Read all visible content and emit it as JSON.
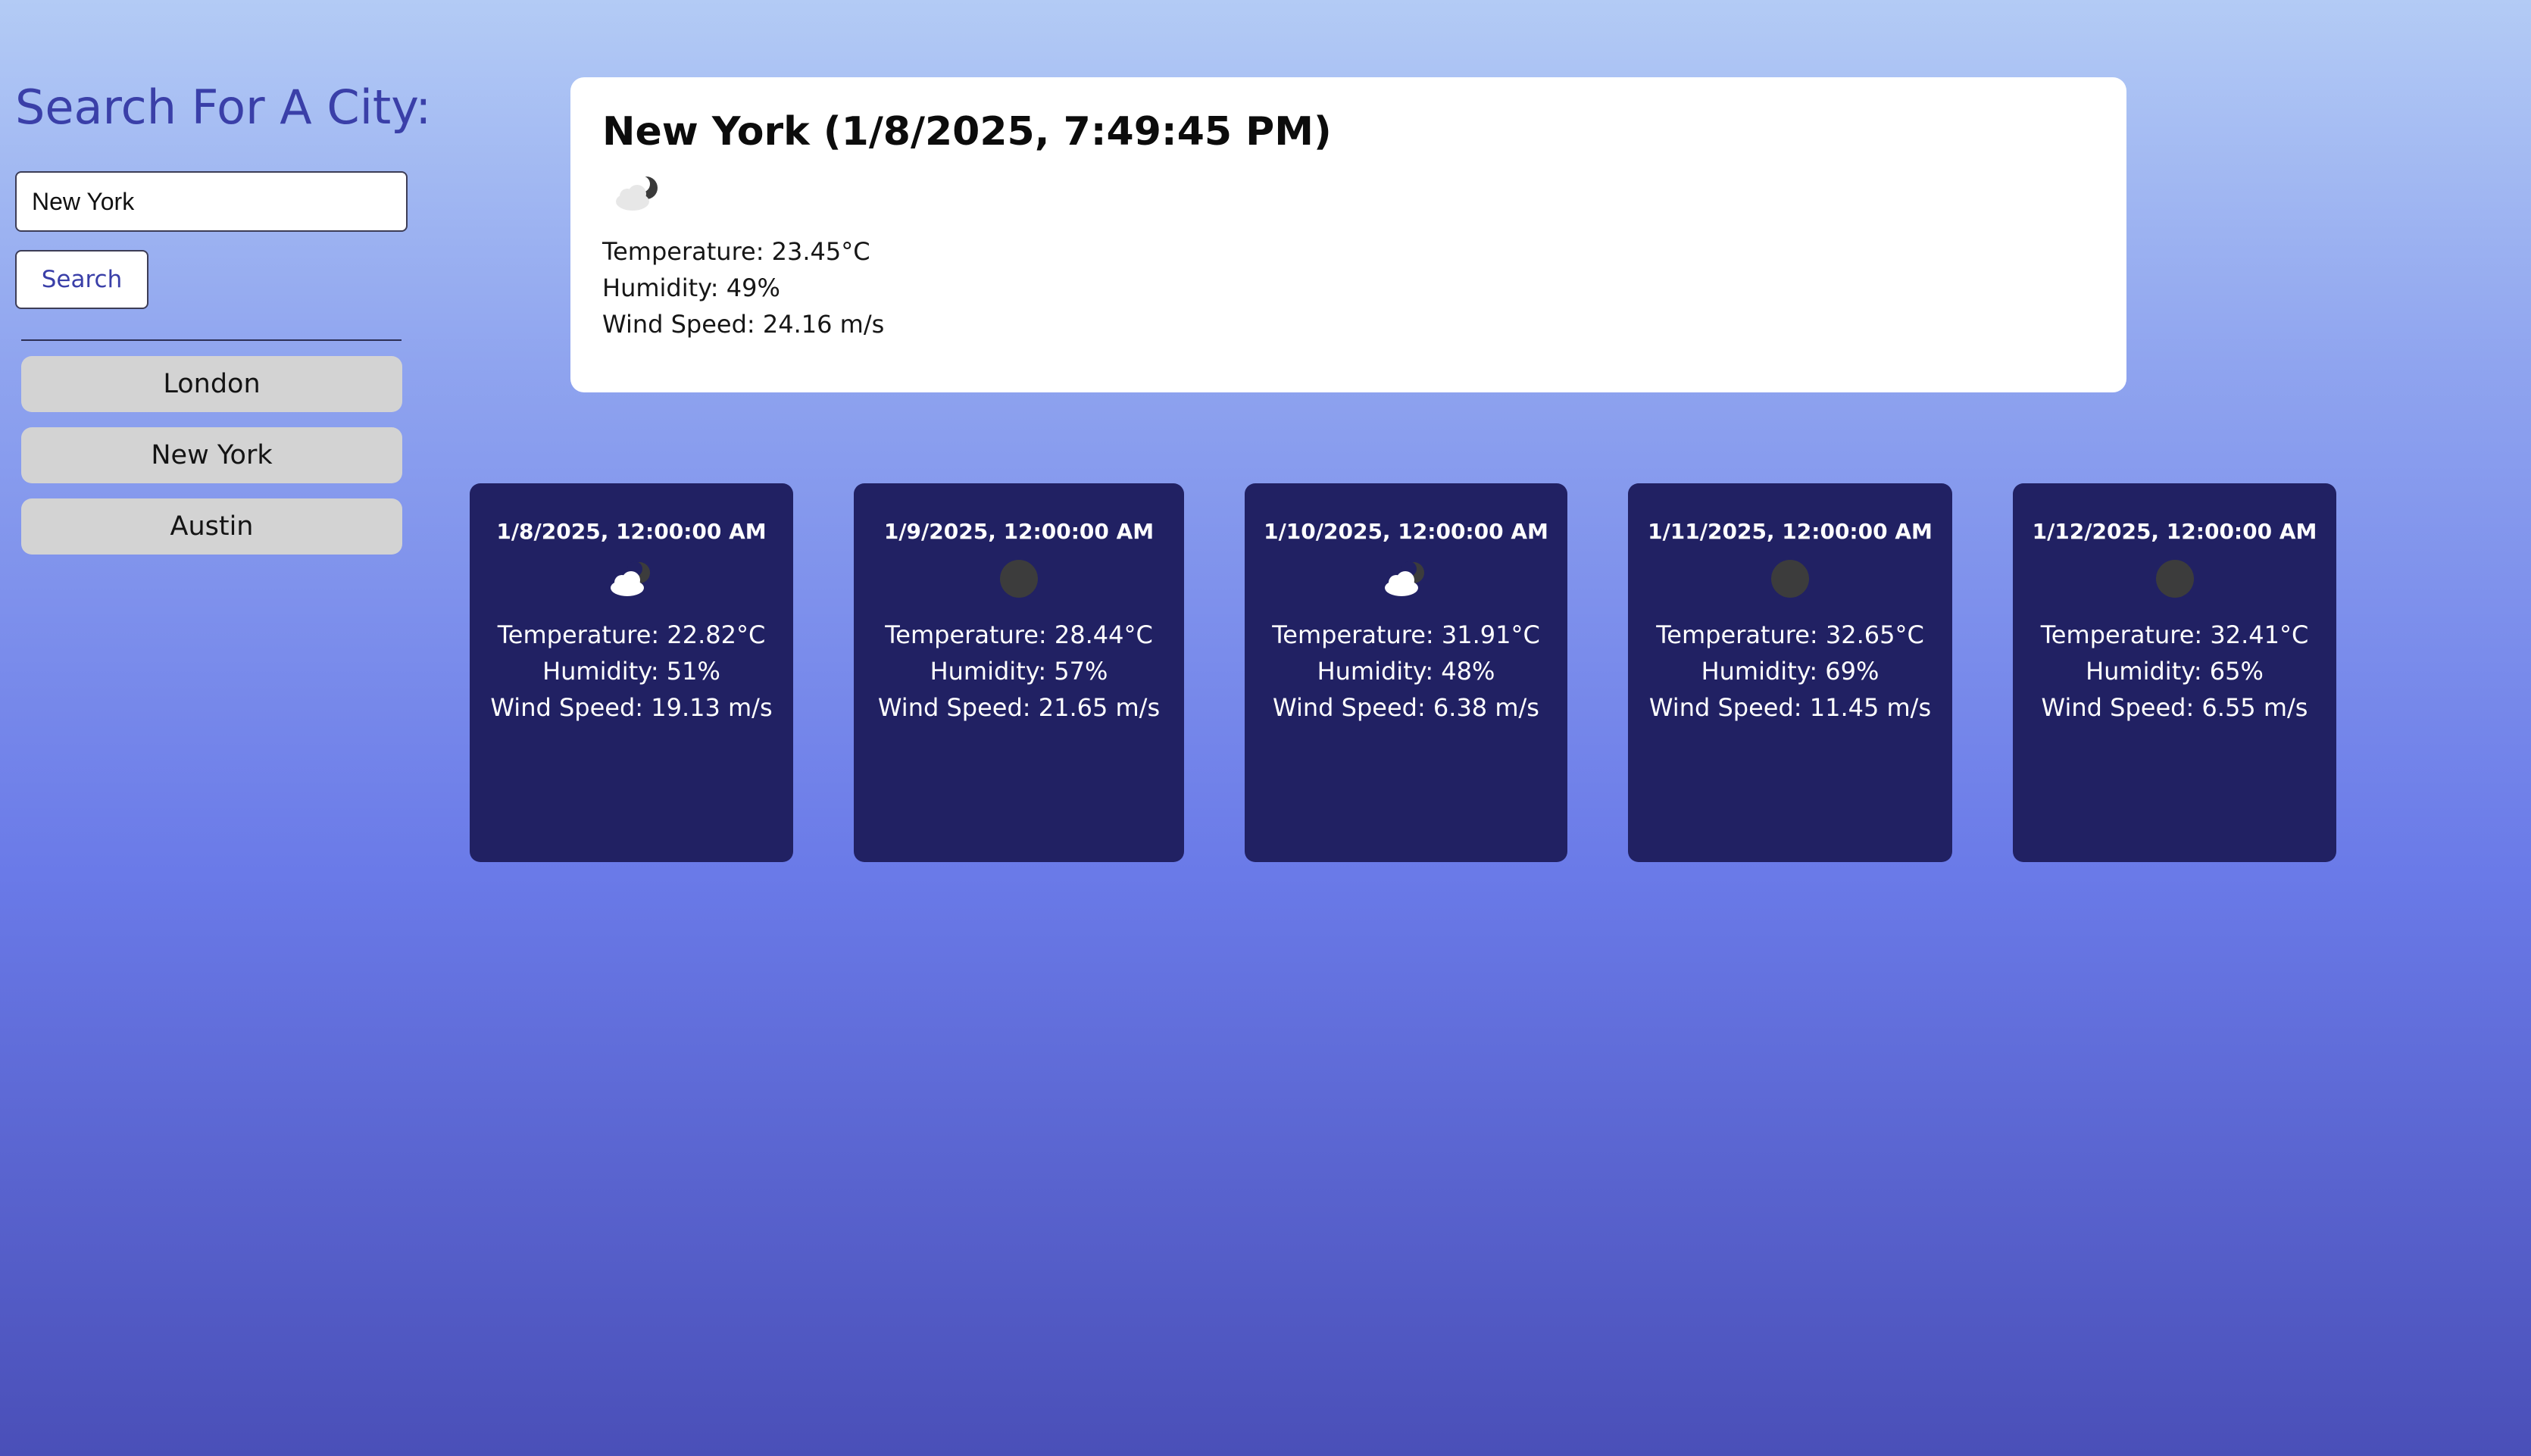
{
  "sidebar": {
    "title": "Search For A City:",
    "search_input": {
      "value": "New York",
      "placeholder": ""
    },
    "search_button_label": "Search",
    "history": [
      {
        "label": "London"
      },
      {
        "label": "New York"
      },
      {
        "label": "Austin"
      }
    ]
  },
  "current": {
    "title": "New York (1/8/2025, 7:49:45 PM)",
    "icon": "partly-cloudy-night-icon",
    "temperature": "Temperature: 23.45°C",
    "humidity": "Humidity: 49%",
    "wind": "Wind Speed: 24.16 m/s"
  },
  "forecast": [
    {
      "date": "1/8/2025, 12:00:00 AM",
      "icon": "partly-cloudy-night-icon",
      "temperature": "Temperature: 22.82°C",
      "humidity": "Humidity: 51%",
      "wind": "Wind Speed: 19.13 m/s"
    },
    {
      "date": "1/9/2025, 12:00:00 AM",
      "icon": "clear-night-icon",
      "temperature": "Temperature: 28.44°C",
      "humidity": "Humidity: 57%",
      "wind": "Wind Speed: 21.65 m/s"
    },
    {
      "date": "1/10/2025, 12:00:00 AM",
      "icon": "partly-cloudy-night-icon",
      "temperature": "Temperature: 31.91°C",
      "humidity": "Humidity: 48%",
      "wind": "Wind Speed: 6.38 m/s"
    },
    {
      "date": "1/11/2025, 12:00:00 AM",
      "icon": "clear-night-icon",
      "temperature": "Temperature: 32.65°C",
      "humidity": "Humidity: 69%",
      "wind": "Wind Speed: 11.45 m/s"
    },
    {
      "date": "1/12/2025, 12:00:00 AM",
      "icon": "clear-night-icon",
      "temperature": "Temperature: 32.41°C",
      "humidity": "Humidity: 65%",
      "wind": "Wind Speed: 6.55 m/s"
    }
  ],
  "colors": {
    "accent": "#3a3fa8",
    "forecast_card": "#212163",
    "history_item": "#d3d3d3"
  }
}
